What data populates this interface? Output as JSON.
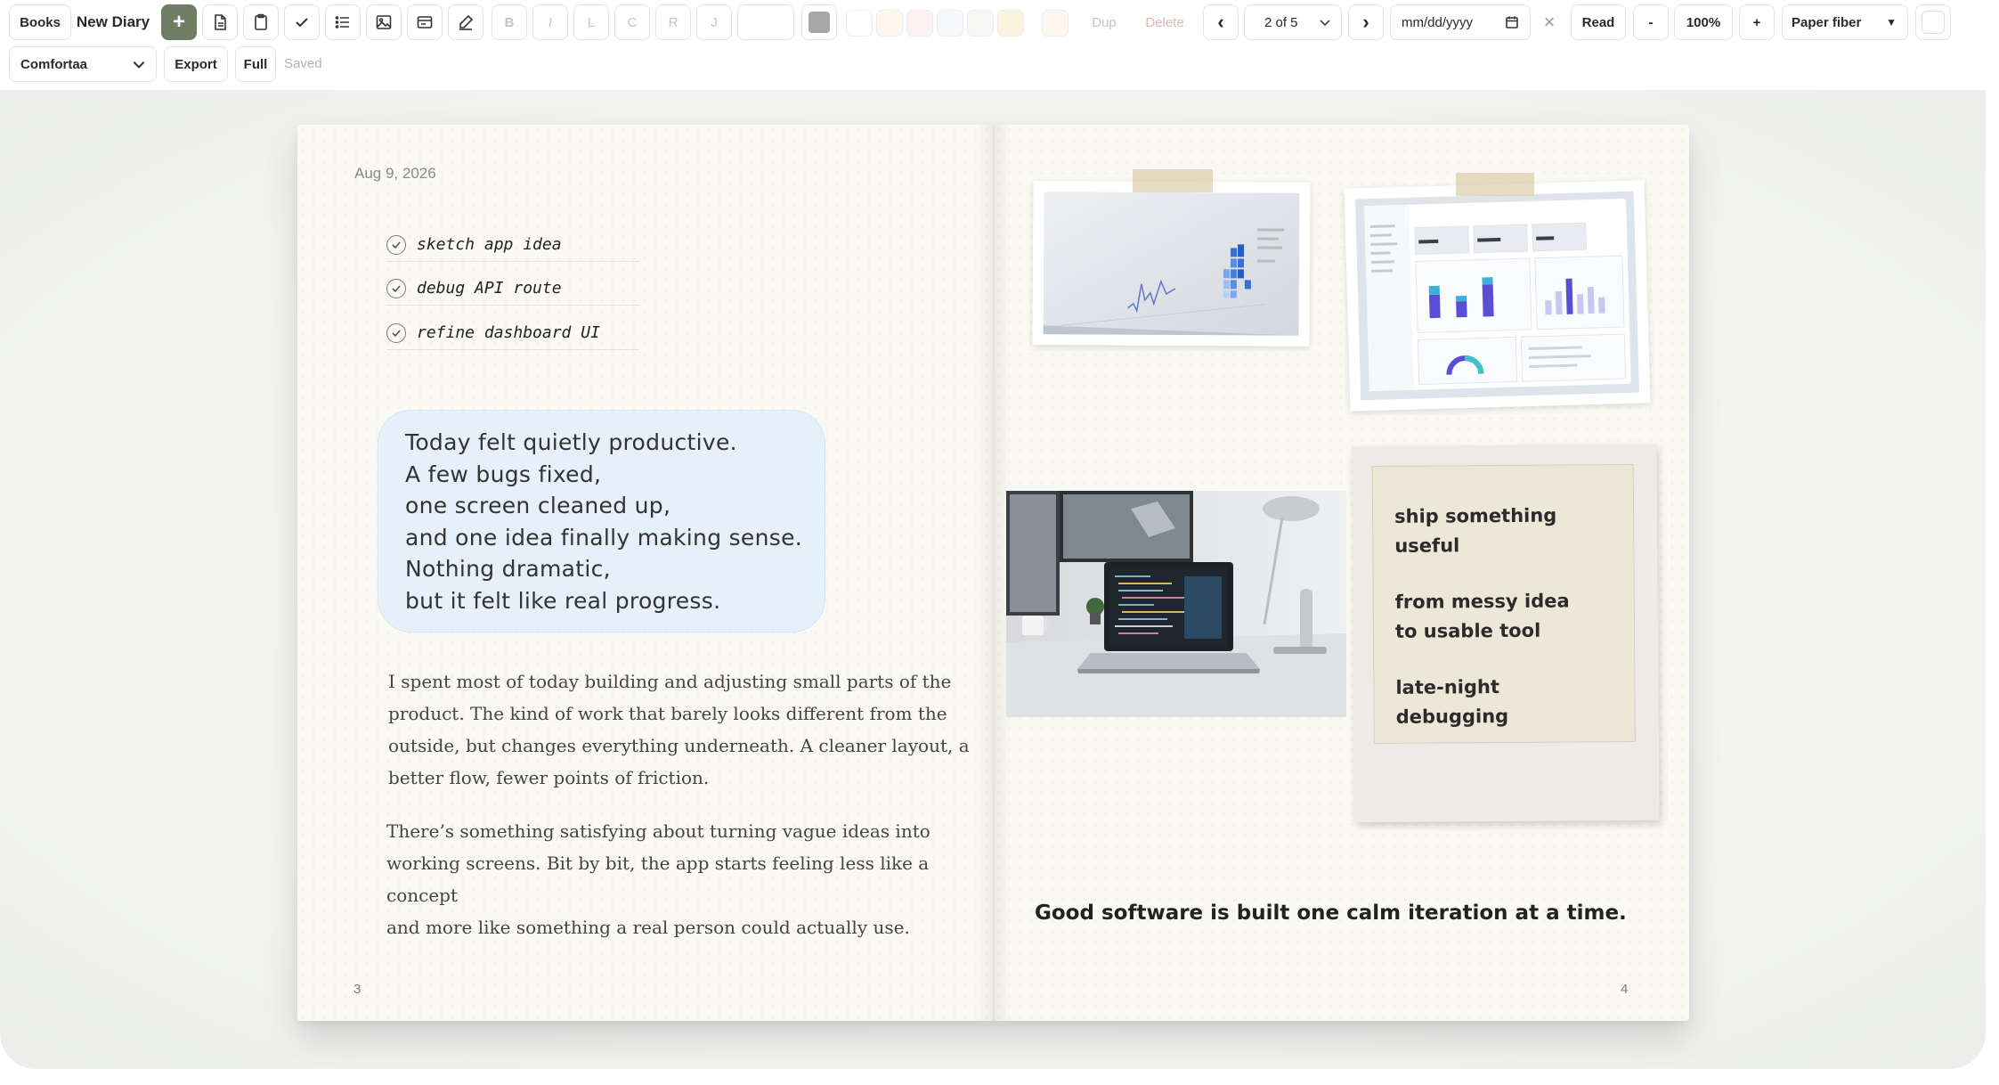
{
  "toolbar": {
    "books_label": "Books",
    "new_diary_label": "New Diary",
    "add_label": "+",
    "bold_label": "B",
    "italic_label": "I",
    "align_left_label": "L",
    "align_center_label": "C",
    "align_right_label": "R",
    "align_justify_label": "J",
    "dup_label": "Dup",
    "delete_label": "Delete",
    "prev_label": "‹",
    "page_indicator": "2 of 5",
    "next_label": "›",
    "date_placeholder": "mm/dd/yyyy",
    "clear_label": "×",
    "read_label": "Read",
    "zoom_out_label": "-",
    "zoom_level": "100%",
    "zoom_in_label": "+",
    "paper_style": "Paper fiber",
    "font_select": "Comfortaa",
    "export_label": "Export",
    "full_label": "Full",
    "status_text": "Saved",
    "swatch_colors": [
      "#ffffff",
      "#fdf8ee",
      "#fdf1f1",
      "#f6f8fb",
      "#f6f6f4",
      "#faf3df",
      "#fbf7ef"
    ],
    "accent_color": "#6f7d63",
    "text_color_swatch": "#a7a7a7"
  },
  "left_page": {
    "date": "Aug 9, 2026",
    "checklist": [
      {
        "label": "sketch app idea",
        "checked": true
      },
      {
        "label": "debug API route",
        "checked": true
      },
      {
        "label": "refine dashboard UI",
        "checked": true
      }
    ],
    "bubble_lines": [
      "Today felt quietly productive.",
      "A few bugs fixed,",
      "one screen cleaned up,",
      "and one idea finally making sense.",
      "Nothing dramatic,",
      "but it felt like real progress."
    ],
    "paragraph_1_lines": [
      "I spent most of today building and adjusting small parts of the",
      "product. The kind of work that barely looks different from the",
      "outside, but changes everything underneath. A cleaner layout, a",
      "better flow, fewer points of friction."
    ],
    "paragraph_2_lines": [
      "There’s something satisfying about turning vague ideas into",
      "working screens. Bit by bit, the app starts feeling less like a concept",
      "and more like something a real person could actually use."
    ],
    "page_number": "3"
  },
  "right_page": {
    "note_lines": [
      "ship something useful",
      "",
      "from messy idea",
      "to usable tool",
      "",
      "late-night debugging"
    ],
    "quote": "Good software is built one calm iteration at a time.",
    "page_number": "4"
  }
}
